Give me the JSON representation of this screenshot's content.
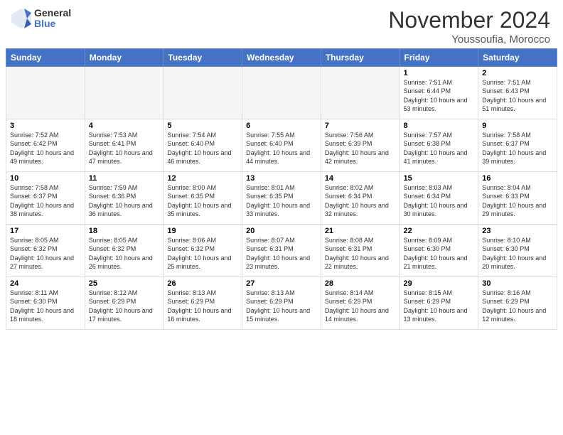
{
  "header": {
    "logo_general": "General",
    "logo_blue": "Blue",
    "month_title": "November 2024",
    "subtitle": "Youssoufia, Morocco"
  },
  "calendar": {
    "days_of_week": [
      "Sunday",
      "Monday",
      "Tuesday",
      "Wednesday",
      "Thursday",
      "Friday",
      "Saturday"
    ],
    "weeks": [
      [
        {
          "day": "",
          "info": "",
          "empty": true
        },
        {
          "day": "",
          "info": "",
          "empty": true
        },
        {
          "day": "",
          "info": "",
          "empty": true
        },
        {
          "day": "",
          "info": "",
          "empty": true
        },
        {
          "day": "",
          "info": "",
          "empty": true
        },
        {
          "day": "1",
          "info": "Sunrise: 7:51 AM\nSunset: 6:44 PM\nDaylight: 10 hours\nand 53 minutes."
        },
        {
          "day": "2",
          "info": "Sunrise: 7:51 AM\nSunset: 6:43 PM\nDaylight: 10 hours\nand 51 minutes."
        }
      ],
      [
        {
          "day": "3",
          "info": "Sunrise: 7:52 AM\nSunset: 6:42 PM\nDaylight: 10 hours\nand 49 minutes."
        },
        {
          "day": "4",
          "info": "Sunrise: 7:53 AM\nSunset: 6:41 PM\nDaylight: 10 hours\nand 47 minutes."
        },
        {
          "day": "5",
          "info": "Sunrise: 7:54 AM\nSunset: 6:40 PM\nDaylight: 10 hours\nand 46 minutes."
        },
        {
          "day": "6",
          "info": "Sunrise: 7:55 AM\nSunset: 6:40 PM\nDaylight: 10 hours\nand 44 minutes."
        },
        {
          "day": "7",
          "info": "Sunrise: 7:56 AM\nSunset: 6:39 PM\nDaylight: 10 hours\nand 42 minutes."
        },
        {
          "day": "8",
          "info": "Sunrise: 7:57 AM\nSunset: 6:38 PM\nDaylight: 10 hours\nand 41 minutes."
        },
        {
          "day": "9",
          "info": "Sunrise: 7:58 AM\nSunset: 6:37 PM\nDaylight: 10 hours\nand 39 minutes."
        }
      ],
      [
        {
          "day": "10",
          "info": "Sunrise: 7:58 AM\nSunset: 6:37 PM\nDaylight: 10 hours\nand 38 minutes."
        },
        {
          "day": "11",
          "info": "Sunrise: 7:59 AM\nSunset: 6:36 PM\nDaylight: 10 hours\nand 36 minutes."
        },
        {
          "day": "12",
          "info": "Sunrise: 8:00 AM\nSunset: 6:35 PM\nDaylight: 10 hours\nand 35 minutes."
        },
        {
          "day": "13",
          "info": "Sunrise: 8:01 AM\nSunset: 6:35 PM\nDaylight: 10 hours\nand 33 minutes."
        },
        {
          "day": "14",
          "info": "Sunrise: 8:02 AM\nSunset: 6:34 PM\nDaylight: 10 hours\nand 32 minutes."
        },
        {
          "day": "15",
          "info": "Sunrise: 8:03 AM\nSunset: 6:34 PM\nDaylight: 10 hours\nand 30 minutes."
        },
        {
          "day": "16",
          "info": "Sunrise: 8:04 AM\nSunset: 6:33 PM\nDaylight: 10 hours\nand 29 minutes."
        }
      ],
      [
        {
          "day": "17",
          "info": "Sunrise: 8:05 AM\nSunset: 6:32 PM\nDaylight: 10 hours\nand 27 minutes."
        },
        {
          "day": "18",
          "info": "Sunrise: 8:05 AM\nSunset: 6:32 PM\nDaylight: 10 hours\nand 26 minutes."
        },
        {
          "day": "19",
          "info": "Sunrise: 8:06 AM\nSunset: 6:32 PM\nDaylight: 10 hours\nand 25 minutes."
        },
        {
          "day": "20",
          "info": "Sunrise: 8:07 AM\nSunset: 6:31 PM\nDaylight: 10 hours\nand 23 minutes."
        },
        {
          "day": "21",
          "info": "Sunrise: 8:08 AM\nSunset: 6:31 PM\nDaylight: 10 hours\nand 22 minutes."
        },
        {
          "day": "22",
          "info": "Sunrise: 8:09 AM\nSunset: 6:30 PM\nDaylight: 10 hours\nand 21 minutes."
        },
        {
          "day": "23",
          "info": "Sunrise: 8:10 AM\nSunset: 6:30 PM\nDaylight: 10 hours\nand 20 minutes."
        }
      ],
      [
        {
          "day": "24",
          "info": "Sunrise: 8:11 AM\nSunset: 6:30 PM\nDaylight: 10 hours\nand 18 minutes."
        },
        {
          "day": "25",
          "info": "Sunrise: 8:12 AM\nSunset: 6:29 PM\nDaylight: 10 hours\nand 17 minutes."
        },
        {
          "day": "26",
          "info": "Sunrise: 8:13 AM\nSunset: 6:29 PM\nDaylight: 10 hours\nand 16 minutes."
        },
        {
          "day": "27",
          "info": "Sunrise: 8:13 AM\nSunset: 6:29 PM\nDaylight: 10 hours\nand 15 minutes."
        },
        {
          "day": "28",
          "info": "Sunrise: 8:14 AM\nSunset: 6:29 PM\nDaylight: 10 hours\nand 14 minutes."
        },
        {
          "day": "29",
          "info": "Sunrise: 8:15 AM\nSunset: 6:29 PM\nDaylight: 10 hours\nand 13 minutes."
        },
        {
          "day": "30",
          "info": "Sunrise: 8:16 AM\nSunset: 6:29 PM\nDaylight: 10 hours\nand 12 minutes."
        }
      ]
    ]
  }
}
